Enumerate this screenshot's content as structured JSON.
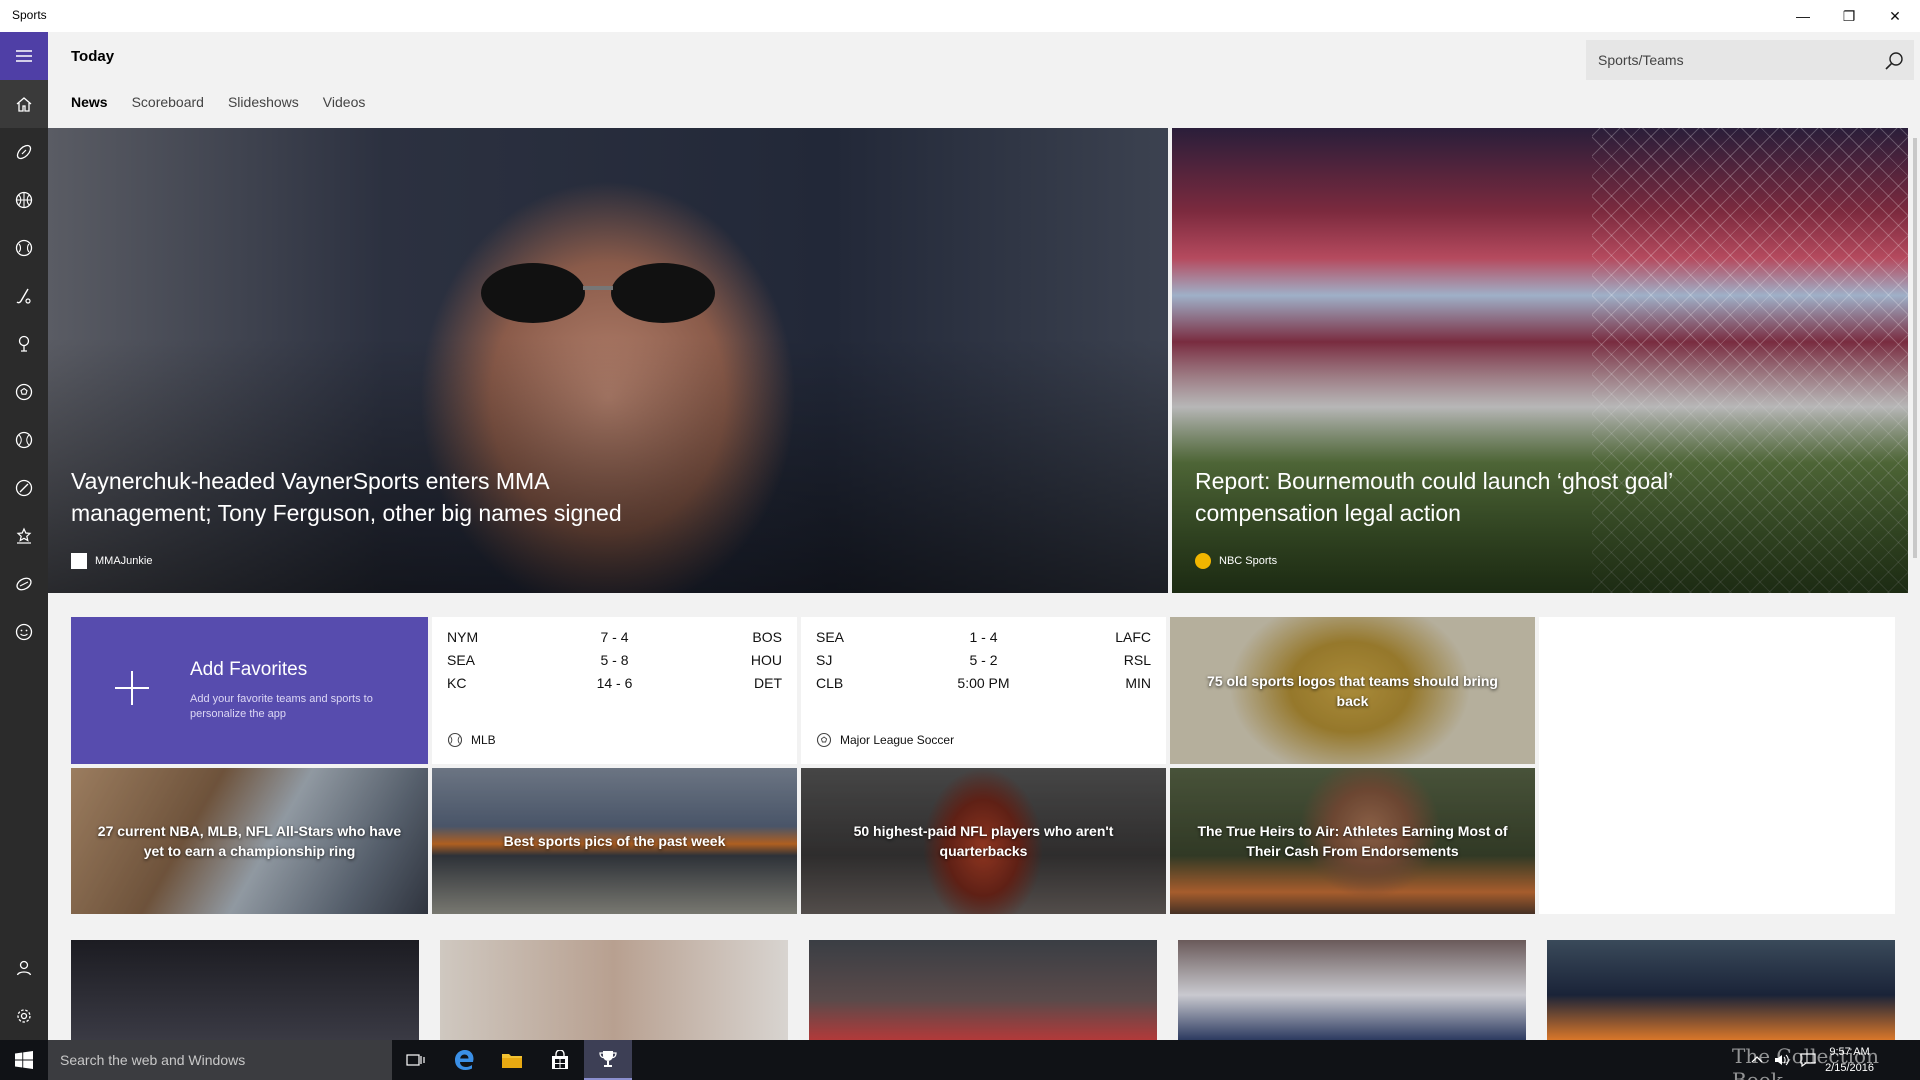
{
  "window": {
    "title": "Sports",
    "minimize_glyph": "—",
    "maximize_glyph": "❐",
    "close_glyph": "✕"
  },
  "header": {
    "title": "Today",
    "search_placeholder": "Sports/Teams"
  },
  "tabs": [
    {
      "label": "News",
      "active": true
    },
    {
      "label": "Scoreboard",
      "active": false
    },
    {
      "label": "Slideshows",
      "active": false
    },
    {
      "label": "Videos",
      "active": false
    }
  ],
  "rail": {
    "items": [
      "home-icon",
      "football-icon",
      "basketball-icon",
      "baseball-icon",
      "hockey-icon",
      "golf-icon",
      "soccer-icon",
      "tennis-icon",
      "cricket-icon",
      "stars-icon",
      "rugby-icon",
      "fantasy-icon"
    ],
    "bottom": [
      "account-icon",
      "settings-icon"
    ]
  },
  "heroes": [
    {
      "headline": "Vaynerchuk-headed VaynerSports enters MMA management; Tony Ferguson, other big names signed",
      "source": "MMAJunkie"
    },
    {
      "headline": "Report: Bournemouth could launch ‘ghost goal’ compensation legal action",
      "source": "NBC Sports"
    }
  ],
  "favorites": {
    "title": "Add Favorites",
    "subtitle": "Add your favorite teams and sports to personalize the app"
  },
  "scoreboards": [
    {
      "league": "MLB",
      "games": [
        {
          "team1": "NYM",
          "score": "7  -  4",
          "team2": "BOS"
        },
        {
          "team1": "SEA",
          "score": "5  -  8",
          "team2": "HOU"
        },
        {
          "team1": "KC",
          "score": "14  -  6",
          "team2": "DET"
        }
      ]
    },
    {
      "league": "Major League Soccer",
      "games": [
        {
          "team1": "SEA",
          "score": "1  -  4",
          "team2": "LAFC"
        },
        {
          "team1": "SJ",
          "score": "5  -  2",
          "team2": "RSL"
        },
        {
          "team1": "CLB",
          "score": "5:00 PM",
          "team2": "MIN"
        }
      ]
    }
  ],
  "photo_tiles": [
    {
      "caption": "75 old sports logos that teams should bring back"
    },
    {
      "caption": "27 current NBA, MLB, NFL All-Stars who have yet to earn a championship ring"
    },
    {
      "caption": "Best sports pics of the past week"
    },
    {
      "caption": "50 highest-paid NFL players who aren't quarterbacks"
    },
    {
      "caption": "The True Heirs to Air: Athletes Earning Most of Their Cash From Endorsements"
    }
  ],
  "taskbar": {
    "search_placeholder": "Search the web and Windows",
    "time": "9:57 AM",
    "date": "2/15/2016",
    "watermark": "The Collection Book"
  }
}
